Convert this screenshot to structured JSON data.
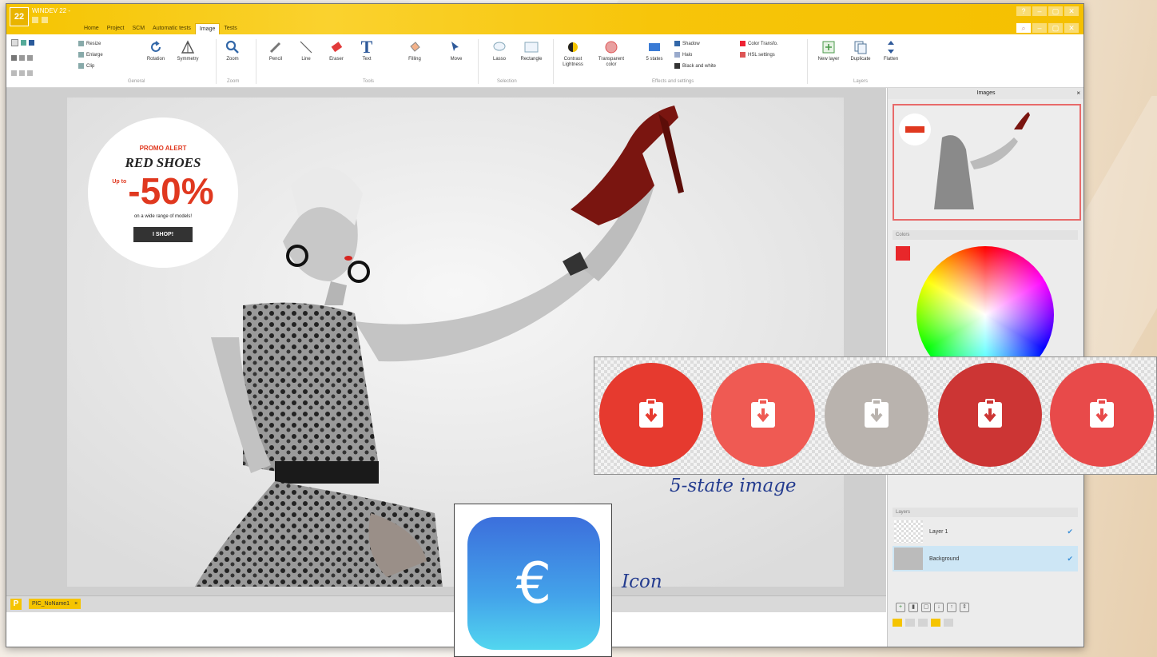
{
  "app": {
    "title": "WINDEV 22 -"
  },
  "tabs": [
    "Home",
    "Project",
    "SCM",
    "Automatic tests",
    "Image",
    "Tests"
  ],
  "active_tab": "Image",
  "ribbon": {
    "resize": "Resize",
    "enlarge": "Enlarge",
    "clip": "Clip",
    "rotation": "Rotation",
    "symmetry": "Symmetry",
    "zoom": "Zoom",
    "pencil": "Pencil",
    "line": "Line",
    "eraser": "Eraser",
    "text": "Text",
    "filling": "Filling",
    "move": "Move",
    "lasso": "Lasso",
    "rectangle": "Rectangle",
    "contrast": "Contrast\nLightness",
    "transparent": "Transparent\ncolor",
    "five_states": "5 states",
    "shadow": "Shadow",
    "halo": "Halo",
    "black_white": "Black and white",
    "color_transfo": "Color Transfo.",
    "hsl": "HSL settings",
    "new_layer": "New layer",
    "duplicate": "Duplicate",
    "flatten": "Flatten",
    "groups": [
      "General",
      "Zoom",
      "Tools",
      "Selection",
      "Effects and settings",
      "Layers"
    ]
  },
  "promo": {
    "alert": "PROMO ALERT",
    "headline": "RED SHOES",
    "upto": "Up to",
    "discount": "-50%",
    "sub": "on a wide range of models!",
    "cta": "I SHOP!"
  },
  "doc_tab": "PIC_NoName1",
  "doc_tab_close": "×",
  "panel": {
    "images_title": "Images",
    "close": "×",
    "colors_title": "Colors",
    "layers_title": "Layers",
    "current_color": "#e8272a"
  },
  "layers": [
    {
      "name": "Layer 1",
      "visible": true
    },
    {
      "name": "Background",
      "visible": true,
      "selected": true
    }
  ],
  "five_state": {
    "caption": "5-state image",
    "colors": [
      "#e63a2f",
      "#ef5a53",
      "#b9b3ae",
      "#cc3534",
      "#e84a4a"
    ]
  },
  "icon_example": {
    "caption": "Icon",
    "symbol": "€"
  }
}
